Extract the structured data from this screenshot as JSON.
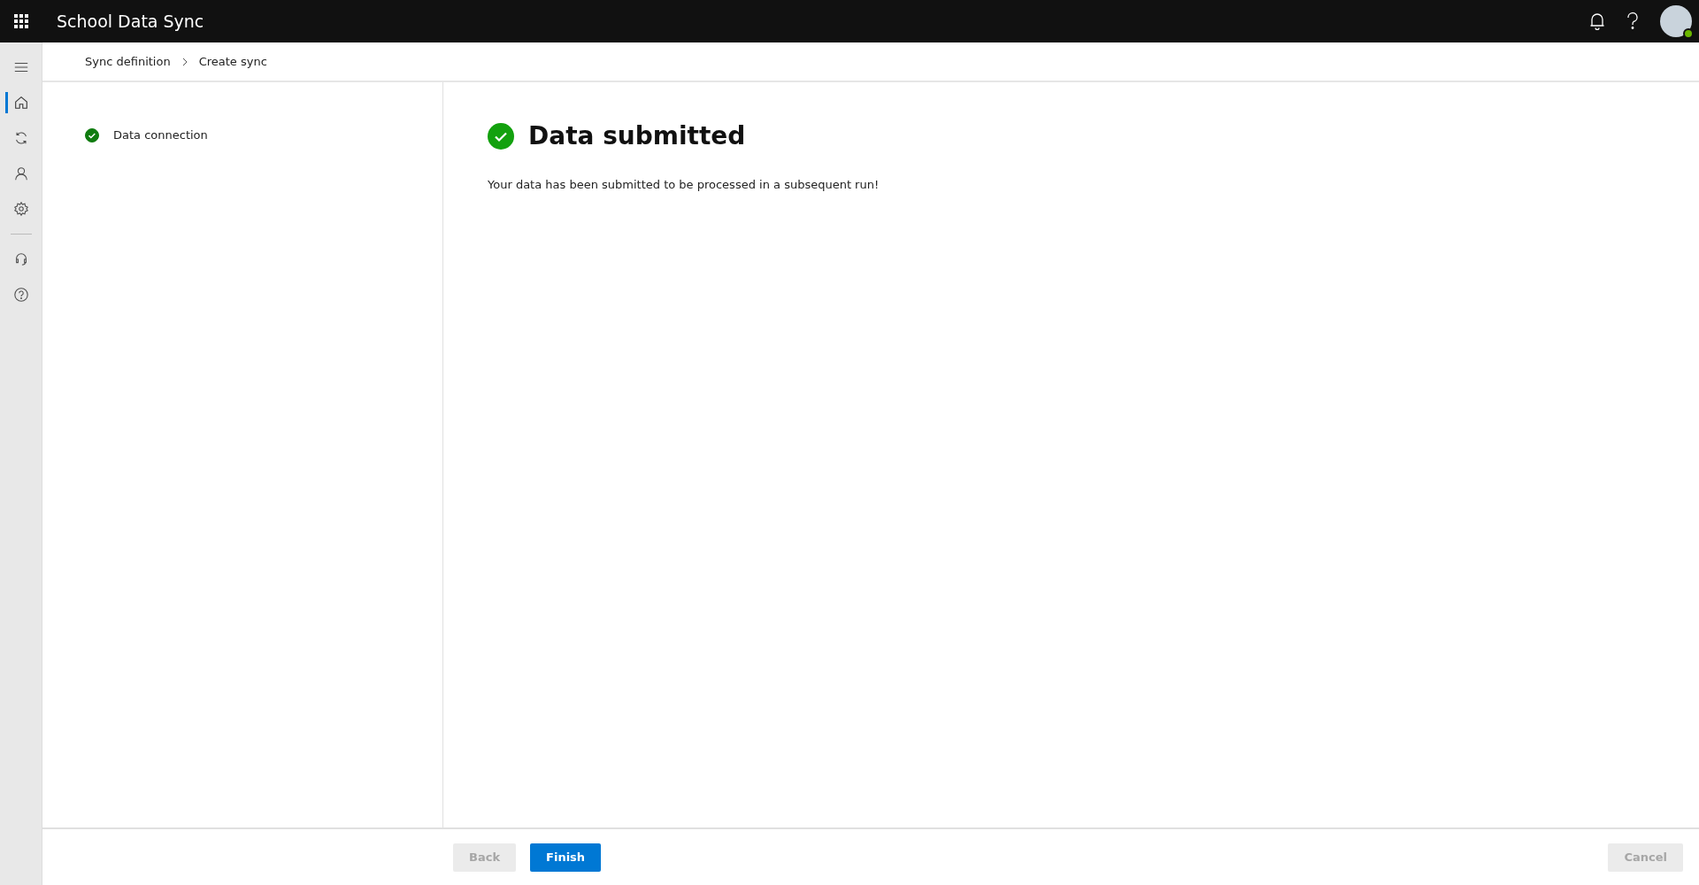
{
  "app": {
    "title": "School Data Sync"
  },
  "nav_items": [
    {
      "kind": "menu",
      "selected": false
    },
    {
      "kind": "home",
      "selected": true
    },
    {
      "kind": "sync",
      "selected": false
    },
    {
      "kind": "person",
      "selected": false
    },
    {
      "kind": "settings",
      "selected": false
    },
    {
      "kind": "divider"
    },
    {
      "kind": "support",
      "selected": false
    },
    {
      "kind": "help",
      "selected": false
    }
  ],
  "breadcrumb": [
    "Sync definition",
    "Create sync"
  ],
  "steps": [
    {
      "label": "Data connection",
      "done": true
    }
  ],
  "result": {
    "title": "Data submitted",
    "message": "Your data has been submitted to be processed in a subsequent run!"
  },
  "buttons": [
    {
      "label": "Back",
      "kind": "secondary",
      "disabled": true
    },
    {
      "label": "Finish",
      "kind": "primary",
      "disabled": false
    },
    {
      "label": "Cancel",
      "kind": "secondary",
      "disabled": true
    }
  ]
}
